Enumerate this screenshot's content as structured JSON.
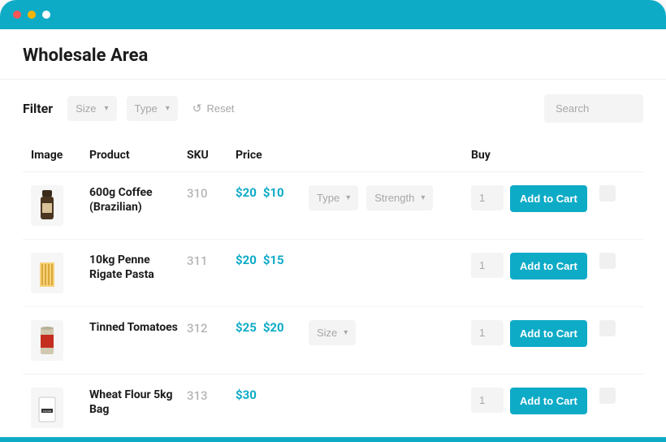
{
  "brand_color": "#0eabc7",
  "page_title": "Wholesale Area",
  "filter": {
    "label": "Filter",
    "size_label": "Size",
    "type_label": "Type",
    "reset_label": "Reset"
  },
  "search": {
    "placeholder": "Search"
  },
  "columns": {
    "image": "Image",
    "product": "Product",
    "sku": "SKU",
    "price": "Price",
    "buy": "Buy"
  },
  "row_actions": {
    "add_to_cart": "Add to Cart",
    "default_qty": "1"
  },
  "products": [
    {
      "name": "600g Coffee (Brazilian)",
      "sku": "310",
      "price_original": "$20",
      "price_current": "$10",
      "options": [
        {
          "label": "Type"
        },
        {
          "label": "Strength"
        }
      ]
    },
    {
      "name": "10kg Penne Rigate Pasta",
      "sku": "311",
      "price_original": "$20",
      "price_current": "$15",
      "options": []
    },
    {
      "name": "Tinned Tomatoes",
      "sku": "312",
      "price_original": "$25",
      "price_current": "$20",
      "options": [
        {
          "label": "Size"
        }
      ]
    },
    {
      "name": "Wheat Flour 5kg Bag",
      "sku": "313",
      "price_original": "",
      "price_current": "$30",
      "options": []
    }
  ]
}
